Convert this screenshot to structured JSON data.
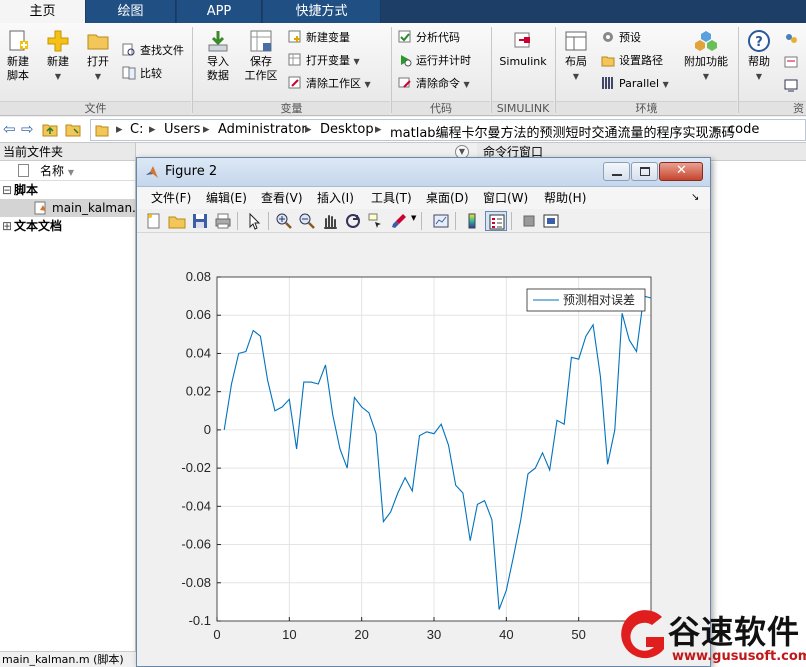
{
  "tabs": [
    {
      "label": "主页",
      "active": true
    },
    {
      "label": "绘图",
      "active": false
    },
    {
      "label": "APP",
      "active": false
    },
    {
      "label": "快捷方式",
      "active": false
    }
  ],
  "ribbon": {
    "file": {
      "new_script": "新建\n脚本",
      "new": "新建",
      "open": "打开",
      "find_files": "查找文件",
      "compare": "比较",
      "section": "文件"
    },
    "variable": {
      "import": "导入\n数据",
      "save_workspace": "保存\n工作区",
      "new_variable": "新建变量",
      "open_variable": "打开变量",
      "clear_workspace": "清除工作区",
      "section": "变量"
    },
    "code": {
      "analyze": "分析代码",
      "run_time": "运行并计时",
      "clear_commands": "清除命令",
      "section": "代码"
    },
    "simulink": {
      "label": "Simulink",
      "section": "SIMULINK"
    },
    "environment": {
      "layout": "布局",
      "preferences": "预设",
      "set_path": "设置路径",
      "parallel": "Parallel",
      "addons": "附加功能",
      "section": "环境"
    },
    "resources": {
      "help": "帮助",
      "section": "资"
    }
  },
  "address": {
    "crumbs": [
      "C:",
      "Users",
      "Administrator",
      "Desktop",
      "matlab编程卡尔曼方法的预测短时交通流量的程序实现源码",
      "code"
    ]
  },
  "left_panel": {
    "title": "当前文件夹",
    "column_name": "名称",
    "groups": [
      {
        "label": "脚本",
        "items": [
          "main_kalman.m"
        ]
      },
      {
        "label": "文本文档",
        "items": []
      }
    ],
    "status": "main_kalman.m (脚本)"
  },
  "cmd_panel": {
    "title": "命令行窗口"
  },
  "figure": {
    "title": "Figure 2",
    "menu": [
      "文件(F)",
      "编辑(E)",
      "查看(V)",
      "插入(I)",
      "工具(T)",
      "桌面(D)",
      "窗口(W)",
      "帮助(H)"
    ]
  },
  "chart_data": {
    "type": "line",
    "title": "",
    "xlabel": "",
    "ylabel": "",
    "xlim": [
      0,
      60
    ],
    "ylim": [
      -0.1,
      0.08
    ],
    "xticks": [
      0,
      10,
      20,
      30,
      40,
      50
    ],
    "yticks": [
      0.08,
      0.06,
      0.04,
      0.02,
      0,
      -0.02,
      -0.04,
      -0.06,
      -0.08,
      -0.1
    ],
    "ytick_labels": [
      "0.08",
      "0.06",
      "0.04",
      "0.02",
      "0",
      "-0.02",
      "-0.04",
      "-0.06",
      "-0.08",
      "-0.1"
    ],
    "grid": true,
    "legend_position": "top-right",
    "series": [
      {
        "name": "预测相对误差",
        "color": "#0072bd",
        "x": [
          1,
          2,
          3,
          4,
          5,
          6,
          7,
          8,
          9,
          10,
          11,
          12,
          13,
          14,
          15,
          16,
          17,
          18,
          19,
          20,
          21,
          22,
          23,
          24,
          25,
          26,
          27,
          28,
          29,
          30,
          31,
          32,
          33,
          34,
          35,
          36,
          37,
          38,
          39,
          40,
          41,
          42,
          43,
          44,
          45,
          46,
          47,
          48,
          49,
          50,
          51,
          52,
          53,
          54,
          55,
          56,
          57,
          58,
          59,
          60
        ],
        "y": [
          0.0,
          0.024,
          0.04,
          0.041,
          0.052,
          0.049,
          0.026,
          0.01,
          0.012,
          0.016,
          -0.01,
          0.025,
          0.025,
          0.024,
          0.034,
          0.008,
          -0.01,
          -0.02,
          0.017,
          0.012,
          0.009,
          -0.002,
          -0.048,
          -0.043,
          -0.033,
          -0.025,
          -0.032,
          -0.003,
          -0.001,
          -0.002,
          0.003,
          -0.008,
          -0.029,
          -0.033,
          -0.058,
          -0.039,
          -0.037,
          -0.047,
          -0.094,
          -0.084,
          -0.066,
          -0.047,
          -0.023,
          -0.02,
          -0.012,
          -0.021,
          0.005,
          0.003,
          0.038,
          0.037,
          0.049,
          0.055,
          0.028,
          -0.018,
          0.0,
          0.061,
          0.047,
          0.041,
          0.07,
          0.069
        ]
      }
    ]
  },
  "watermark": {
    "brand": "谷速软件",
    "url": "www.gususoft.com"
  }
}
